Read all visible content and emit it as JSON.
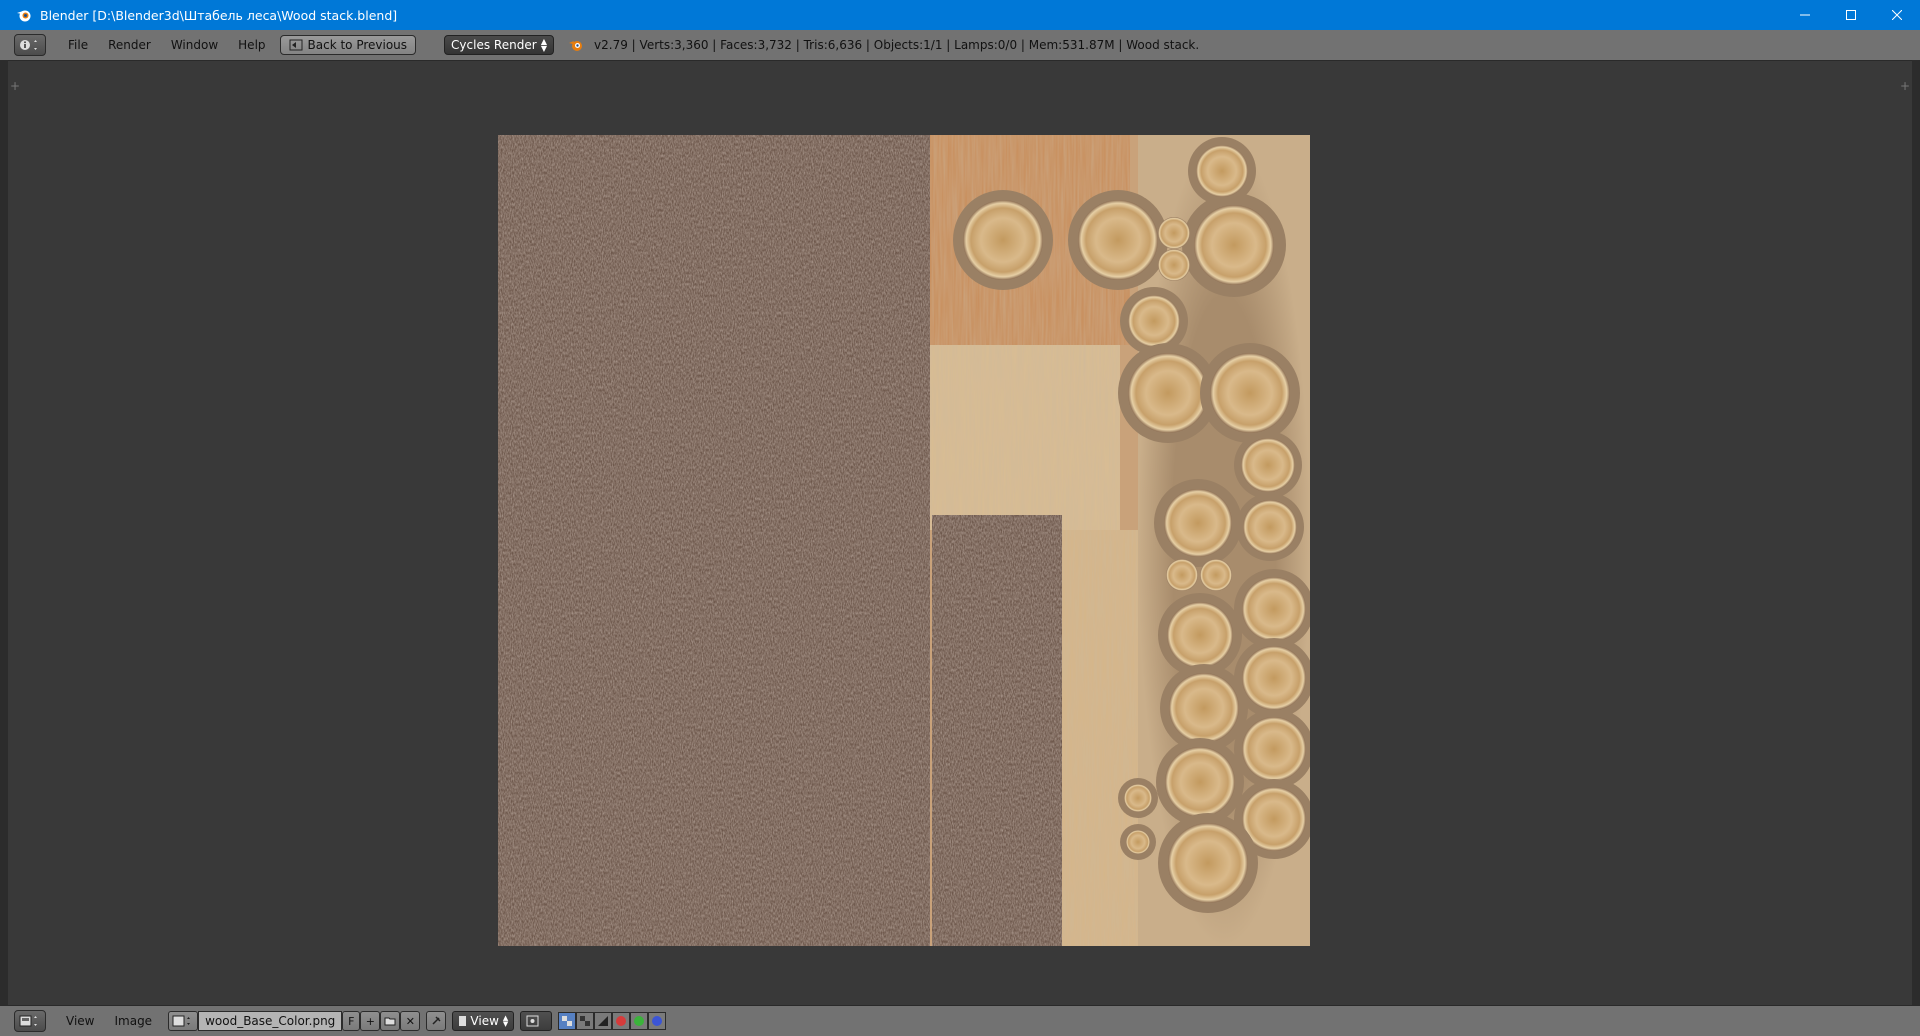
{
  "window": {
    "title": "Blender [D:\\Blender3d\\Штабель леса\\Wood stack.blend]",
    "controls": [
      "minimize-icon",
      "maximize-icon",
      "close-icon"
    ]
  },
  "info_header": {
    "editor_type_icon": "info-icon",
    "menus": [
      "File",
      "Render",
      "Window",
      "Help"
    ],
    "back_button": "Back to Previous",
    "render_engine": "Cycles Render",
    "stats": "v2.79 | Verts:3,360 | Faces:3,732 | Tris:6,636 | Objects:1/1 | Lamps:0/0 | Mem:531.87M | Wood stack."
  },
  "image_editor": {
    "header": {
      "editor_type_icon": "image-editor-icon",
      "menus": [
        "View",
        "Image"
      ],
      "image_name": "wood_Base_Color.png",
      "fake_user": "F",
      "mode_select": "View"
    },
    "texture_colors": {
      "bark": "#6d574b",
      "plank": "#d2b48a",
      "ring": "#c9a36b",
      "ring_dark": "#8e7055",
      "background": "#393939"
    }
  },
  "colors": {
    "titlebar": "#0078d7",
    "header": "#727272",
    "accent": "#5680c2"
  }
}
